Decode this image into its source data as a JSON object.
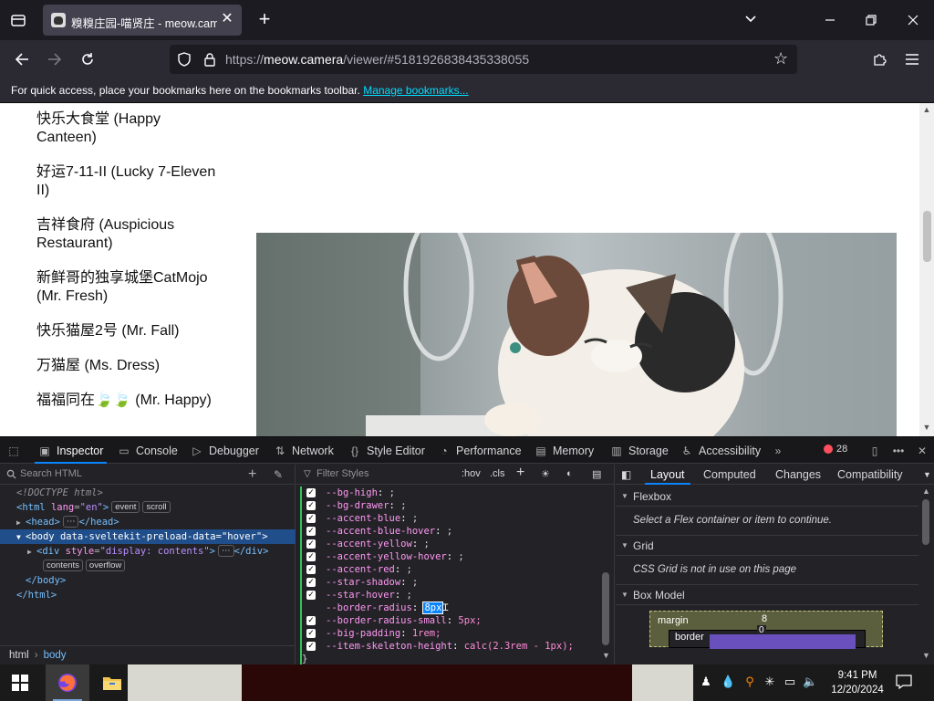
{
  "browser": {
    "tab_title": "糗糗庄园-喵贤庄 - meow.camera",
    "url_prefix": "https://",
    "url_domain": "meow.camera",
    "url_path": "/viewer/#5181926838435338055",
    "bookmarks_text": "For quick access, place your bookmarks here on the bookmarks toolbar.",
    "bookmarks_link": "Manage bookmarks..."
  },
  "page": {
    "houses": [
      "快乐大食堂 (Happy Canteen)",
      "好运7-11-II (Lucky 7-Eleven II)",
      "吉祥食府 (Auspicious Restaurant)",
      "新鲜哥的独享城堡CatMojo (Mr. Fresh)",
      "快乐猫屋2号 (Mr. Fall)",
      "万猫屋 (Ms. Dress)",
      "福福同在🍃🍃 (Mr. Happy)"
    ]
  },
  "devtools": {
    "tabs": [
      "Inspector",
      "Console",
      "Debugger",
      "Network",
      "Style Editor",
      "Performance",
      "Memory",
      "Storage",
      "Accessibility"
    ],
    "error_count": "28",
    "search_placeholder": "Search HTML",
    "tree": {
      "doctype": "<!DOCTYPE html>",
      "html_open": "<html",
      "html_lang_attr": "lang",
      "html_lang_val": "\"en\"",
      "html_close_bracket": ">",
      "badge_event": "event",
      "badge_scroll": "scroll",
      "head": "<head>",
      "head_close": "</head>",
      "body_open": "<body",
      "body_attr": "data-sveltekit-preload-data",
      "body_val": "\"hover\"",
      "div_open": "<div",
      "div_attr": "style",
      "div_val": "\"display: contents\"",
      "div_close": "</div>",
      "badge_contents": "contents",
      "badge_overflow": "overflow",
      "body_close": "</body>",
      "html_close": "</html>"
    },
    "breadcrumbs": [
      "html",
      "body"
    ],
    "filter_placeholder": "Filter Styles",
    "hov_label": ":hov",
    "cls_label": ".cls",
    "declarations": [
      {
        "prop": "--bg-high",
        "value": ";",
        "checked": true
      },
      {
        "prop": "--bg-drawer",
        "value": ";",
        "checked": true
      },
      {
        "prop": "--accent-blue",
        "value": ";",
        "checked": true
      },
      {
        "prop": "--accent-blue-hover",
        "value": ";",
        "checked": true
      },
      {
        "prop": "--accent-yellow",
        "value": ";",
        "checked": true
      },
      {
        "prop": "--accent-yellow-hover",
        "value": ";",
        "checked": true
      },
      {
        "prop": "--accent-red",
        "value": ";",
        "checked": true
      },
      {
        "prop": "--star-shadow",
        "value": ";",
        "checked": true
      },
      {
        "prop": "--star-hover",
        "value": ";",
        "checked": true
      },
      {
        "prop": "--border-radius",
        "value": "8px",
        "checked": false,
        "editing": true
      },
      {
        "prop": "--border-radius-small",
        "value": "5px;",
        "checked": true
      },
      {
        "prop": "--big-padding",
        "value": "1rem;",
        "checked": true
      },
      {
        "prop": "--item-skeleton-height",
        "value": "calc(2.3rem - 1px);",
        "checked": true
      }
    ],
    "closing_brace": "}",
    "layout_tabs": [
      "Layout",
      "Computed",
      "Changes",
      "Compatibility"
    ],
    "flexbox_title": "Flexbox",
    "flexbox_msg": "Select a Flex container or item to continue.",
    "grid_title": "Grid",
    "grid_msg": "CSS Grid is not in use on this page",
    "boxmodel_title": "Box Model",
    "bm_margin_label": "margin",
    "bm_margin_value": "8",
    "bm_border_label": "border",
    "bm_border_value": "0"
  },
  "taskbar": {
    "time": "9:41 PM",
    "date": "12/20/2024"
  },
  "colors": {
    "accent": "#0a84ff",
    "link": "#00ddff",
    "selected_node": "#204e8a"
  }
}
